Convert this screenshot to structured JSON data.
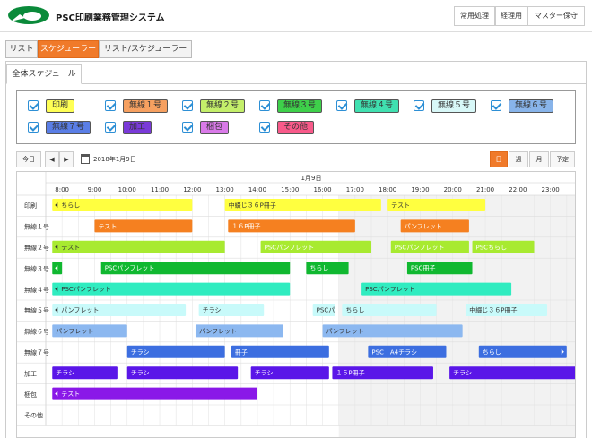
{
  "header": {
    "title": "PSC印刷業務管理システム",
    "buttons": [
      "常用処理",
      "経理用",
      "マスター保守"
    ]
  },
  "tabs": [
    "リスト",
    "スケジューラー",
    "リスト/スケジューラー"
  ],
  "panel_tab": "全体スケジュール",
  "filters": [
    {
      "label": "印刷",
      "color": "#ffff55"
    },
    {
      "label": "無線１号",
      "color": "#f6a060"
    },
    {
      "label": "無線２号",
      "color": "#c4ef6a"
    },
    {
      "label": "無線３号",
      "color": "#3ed04a"
    },
    {
      "label": "無線４号",
      "color": "#40e0b0"
    },
    {
      "label": "無線５号",
      "color": "#d8f8f8"
    },
    {
      "label": "無線６号",
      "color": "#88b4ea"
    },
    {
      "label": "無線７号",
      "color": "#5a7ee6"
    },
    {
      "label": "加工",
      "color": "#7a3ad8"
    },
    {
      "label": "梱包",
      "color": "#d97ae8"
    },
    {
      "label": "その他",
      "color": "#f85a8a"
    }
  ],
  "toolbar": {
    "today": "今日",
    "prev": "◀",
    "next": "▶",
    "date": "2018年1月9日",
    "views": [
      "日",
      "週",
      "月",
      "予定"
    ]
  },
  "schedule": {
    "date_header": "1月9日",
    "hours": [
      "8:00",
      "9:00",
      "10:00",
      "11:00",
      "12:00",
      "13:00",
      "14:00",
      "15:00",
      "16:00",
      "17:00",
      "18:00",
      "19:00",
      "20:00",
      "21:00",
      "22:00",
      "23:00"
    ],
    "resources": [
      "印刷",
      "無線１号",
      "無線２号",
      "無線３号",
      "無線４号",
      "無線５号",
      "無線６号",
      "無線７号",
      "加工",
      "梱包",
      "その他"
    ],
    "events": [
      {
        "row": 0,
        "start": 7.7,
        "end": 12.0,
        "label": "ちらし",
        "color": "#ffff40",
        "text": "#333",
        "arrowL": true
      },
      {
        "row": 0,
        "start": 13.0,
        "end": 17.8,
        "label": "中綴じ３６P冊子",
        "color": "#ffff40",
        "text": "#333"
      },
      {
        "row": 0,
        "start": 18.0,
        "end": 21.0,
        "label": "テスト",
        "color": "#ffff40",
        "text": "#333"
      },
      {
        "row": 1,
        "start": 9.0,
        "end": 12.0,
        "label": "テスト",
        "color": "#f58020",
        "text": "#fff"
      },
      {
        "row": 1,
        "start": 13.1,
        "end": 17.0,
        "label": "１６P冊子",
        "color": "#f58020",
        "text": "#fff"
      },
      {
        "row": 1,
        "start": 18.4,
        "end": 20.5,
        "label": "パンフレット",
        "color": "#f58020",
        "text": "#fff"
      },
      {
        "row": 2,
        "start": 7.7,
        "end": 13.0,
        "label": "テスト",
        "color": "#a8ea30",
        "text": "#333",
        "arrowL": true
      },
      {
        "row": 2,
        "start": 14.1,
        "end": 17.5,
        "label": "PSCパンフレット",
        "color": "#a8ea30",
        "text": "#fff"
      },
      {
        "row": 2,
        "start": 18.1,
        "end": 20.5,
        "label": "PSCパンフレット",
        "color": "#a8ea30",
        "text": "#fff"
      },
      {
        "row": 2,
        "start": 20.6,
        "end": 22.5,
        "label": "PSCちらし",
        "color": "#a8ea30",
        "text": "#fff"
      },
      {
        "row": 3,
        "start": 7.7,
        "end": 8.0,
        "label": "",
        "color": "#10b830",
        "text": "#fff",
        "arrowL": true
      },
      {
        "row": 3,
        "start": 9.2,
        "end": 15.0,
        "label": "PSCパンフレット",
        "color": "#10b830",
        "text": "#fff"
      },
      {
        "row": 3,
        "start": 15.5,
        "end": 16.8,
        "label": "ちらし",
        "color": "#10b830",
        "text": "#fff"
      },
      {
        "row": 3,
        "start": 18.6,
        "end": 20.6,
        "label": "PSC冊子",
        "color": "#10b830",
        "text": "#fff"
      },
      {
        "row": 4,
        "start": 7.7,
        "end": 15.0,
        "label": "PSCパンフレット",
        "color": "#30ecc0",
        "text": "#333",
        "arrowL": true
      },
      {
        "row": 4,
        "start": 17.2,
        "end": 21.8,
        "label": "PSCパンフレット",
        "color": "#30ecc0",
        "text": "#333"
      },
      {
        "row": 5,
        "start": 7.7,
        "end": 11.8,
        "label": "パンフレット",
        "color": "#c8fafa",
        "text": "#333",
        "arrowL": true
      },
      {
        "row": 5,
        "start": 12.2,
        "end": 14.2,
        "label": "チラシ",
        "color": "#c8fafa",
        "text": "#333"
      },
      {
        "row": 5,
        "start": 15.7,
        "end": 16.4,
        "label": "PSCパ",
        "color": "#c8fafa",
        "text": "#333"
      },
      {
        "row": 5,
        "start": 16.6,
        "end": 19.5,
        "label": "ちらし",
        "color": "#c8fafa",
        "text": "#333"
      },
      {
        "row": 5,
        "start": 20.4,
        "end": 22.9,
        "label": "中綴じ３６P冊子",
        "color": "#c8fafa",
        "text": "#333"
      },
      {
        "row": 6,
        "start": 7.7,
        "end": 10.0,
        "label": "パンフレット",
        "color": "#8cb8f0",
        "text": "#333"
      },
      {
        "row": 6,
        "start": 12.1,
        "end": 14.8,
        "label": "パンフレット",
        "color": "#8cb8f0",
        "text": "#333"
      },
      {
        "row": 6,
        "start": 16.0,
        "end": 20.3,
        "label": "パンフレット",
        "color": "#8cb8f0",
        "text": "#333"
      },
      {
        "row": 7,
        "start": 10.0,
        "end": 13.0,
        "label": "チラシ",
        "color": "#3c6ee0",
        "text": "#fff"
      },
      {
        "row": 7,
        "start": 13.2,
        "end": 16.2,
        "label": "冊子",
        "color": "#3c6ee0",
        "text": "#fff"
      },
      {
        "row": 7,
        "start": 17.4,
        "end": 19.8,
        "label": "PSC　A4チラシ",
        "color": "#3c6ee0",
        "text": "#fff"
      },
      {
        "row": 7,
        "start": 20.8,
        "end": 23.5,
        "label": "ちらし",
        "color": "#3c6ee0",
        "text": "#fff",
        "arrowR": true
      },
      {
        "row": 8,
        "start": 7.7,
        "end": 9.7,
        "label": "チラシ",
        "color": "#5a16e8",
        "text": "#fff"
      },
      {
        "row": 8,
        "start": 10.0,
        "end": 13.4,
        "label": "チラシ",
        "color": "#5a16e8",
        "text": "#fff"
      },
      {
        "row": 8,
        "start": 13.8,
        "end": 16.2,
        "label": "チラシ",
        "color": "#5a16e8",
        "text": "#fff"
      },
      {
        "row": 8,
        "start": 16.3,
        "end": 19.4,
        "label": "１６P冊子",
        "color": "#5a16e8",
        "text": "#fff"
      },
      {
        "row": 8,
        "start": 19.9,
        "end": 23.8,
        "label": "チラシ",
        "color": "#5a16e8",
        "text": "#fff"
      },
      {
        "row": 9,
        "start": 7.7,
        "end": 14.0,
        "label": "テスト",
        "color": "#8a18e8",
        "text": "#fff",
        "arrowL": true
      }
    ]
  }
}
